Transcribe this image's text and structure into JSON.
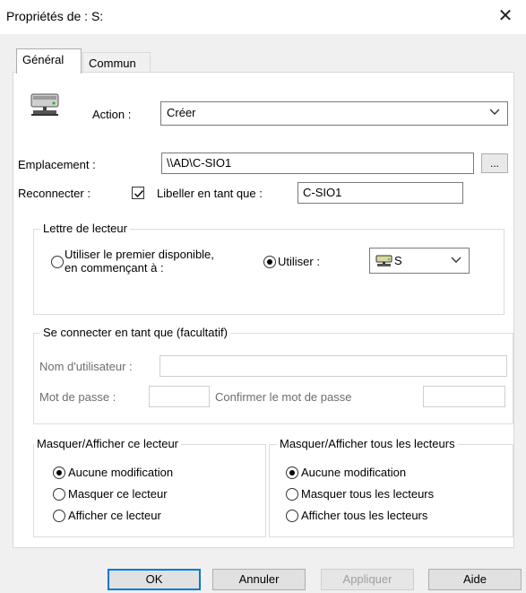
{
  "window": {
    "title": "Propriétés de : S:",
    "close_symbol": "✕"
  },
  "tabs": [
    {
      "label": "Général"
    },
    {
      "label": "Commun"
    }
  ],
  "action": {
    "label": "Action :",
    "value": "Créer",
    "icon": "network-drive-icon"
  },
  "emplacement": {
    "label": "Emplacement :",
    "value": "\\\\AD\\C-SIO1",
    "browse_label": "..."
  },
  "reconnect": {
    "label": "Reconnecter :",
    "checked": true,
    "label_as": "Libeller en tant que :",
    "label_value": "C-SIO1"
  },
  "drive_letter": {
    "legend": "Lettre de lecteur",
    "option_first_line1": "Utiliser le premier disponible,",
    "option_first_line2": "en commençant à :",
    "option_use": "Utiliser :",
    "selected_drive": "S",
    "selected": "use"
  },
  "connect_as": {
    "legend": "Se connecter en tant que (facultatif)",
    "user_label": "Nom d'utilisateur :",
    "password_label": "Mot de passe :",
    "confirm_label": "Confirmer le mot de passe"
  },
  "hide_show_drive": {
    "legend": "Masquer/Afficher ce lecteur",
    "options": [
      "Aucune modification",
      "Masquer ce lecteur",
      "Afficher ce lecteur"
    ],
    "selected_index": 0
  },
  "hide_show_all": {
    "legend": "Masquer/Afficher tous les lecteurs",
    "options": [
      "Aucune modification",
      "Masquer tous les lecteurs",
      "Afficher tous les lecteurs"
    ],
    "selected_index": 0
  },
  "buttons": {
    "ok": "OK",
    "cancel": "Annuler",
    "apply": "Appliquer",
    "help": "Aide"
  }
}
